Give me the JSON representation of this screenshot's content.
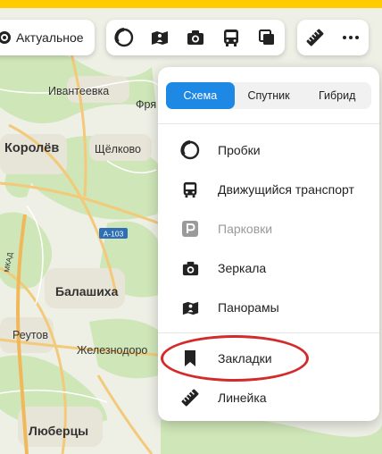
{
  "map": {
    "places": [
      {
        "name": "Ивантеевка",
        "id": "ivanteevka"
      },
      {
        "name": "Фря",
        "id": "frya"
      },
      {
        "name": "Королёв",
        "id": "korolev"
      },
      {
        "name": "Щёлково",
        "id": "shchelkovo"
      },
      {
        "name": "Балашиха",
        "id": "balashikha"
      },
      {
        "name": "Реутов",
        "id": "reutov"
      },
      {
        "name": "Железнодоро",
        "id": "zheleznodoro"
      },
      {
        "name": "Люберцы",
        "id": "lyubertsy"
      },
      {
        "name": "МКАД",
        "id": "mkad"
      }
    ],
    "road_shield": "А-103"
  },
  "toolbar": {
    "actual_label": "Актуальное",
    "layer_icons": [
      "traffic-icon",
      "panorama-icon",
      "camera-icon",
      "bus-icon",
      "layers-icon"
    ],
    "tool_icons": [
      "ruler-icon",
      "more-icon"
    ]
  },
  "panel": {
    "map_types": [
      {
        "label": "Схема",
        "active": true
      },
      {
        "label": "Спутник",
        "active": false
      },
      {
        "label": "Гибрид",
        "active": false
      }
    ],
    "layers": [
      {
        "label": "Пробки",
        "icon": "traffic-icon",
        "disabled": false
      },
      {
        "label": "Движущийся транспорт",
        "icon": "bus-icon",
        "disabled": false
      },
      {
        "label": "Парковки",
        "icon": "parking-icon",
        "disabled": true
      },
      {
        "label": "Зеркала",
        "icon": "camera-icon",
        "disabled": false
      },
      {
        "label": "Панорамы",
        "icon": "panorama-icon",
        "disabled": false
      }
    ],
    "tools": [
      {
        "label": "Закладки",
        "icon": "bookmark-icon",
        "highlighted": true
      },
      {
        "label": "Линейка",
        "icon": "ruler-icon",
        "highlighted": false
      }
    ]
  },
  "colors": {
    "accent": "#1e88e5",
    "highlight": "#d32b2b",
    "topbar": "#ffcc00"
  }
}
